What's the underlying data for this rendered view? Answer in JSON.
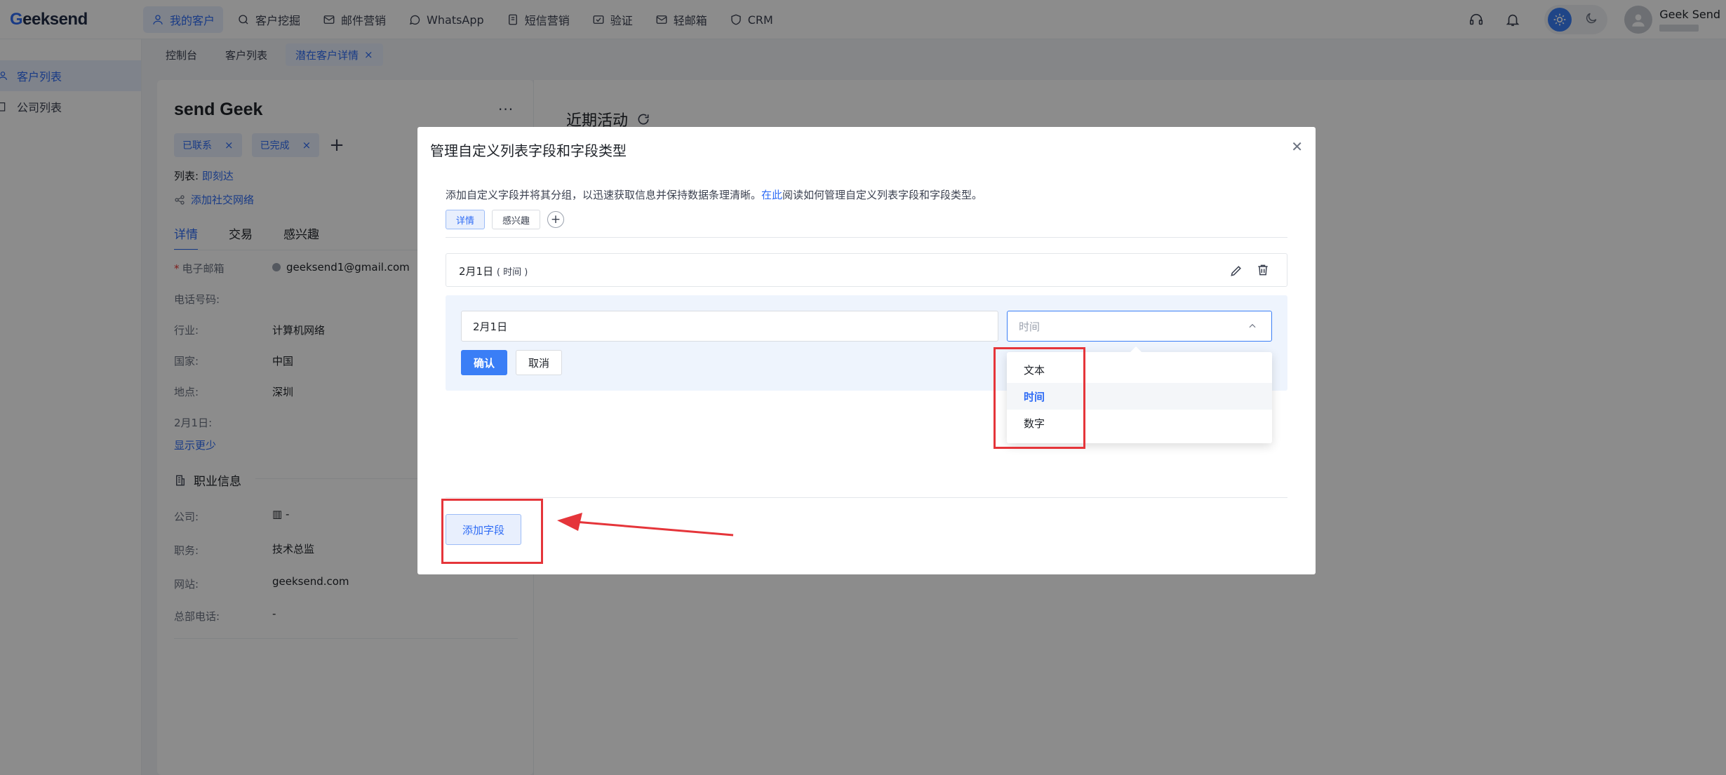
{
  "app": {
    "logo_g": "G",
    "logo_rest": "eeksend"
  },
  "nav": [
    {
      "label": "我的客户",
      "icon": "user-icon"
    },
    {
      "label": "客户挖掘",
      "icon": "search-icon"
    },
    {
      "label": "邮件营销",
      "icon": "mail-icon"
    },
    {
      "label": "WhatsApp",
      "icon": "whatsapp-icon"
    },
    {
      "label": "短信营销",
      "icon": "sms-icon"
    },
    {
      "label": "验证",
      "icon": "verify-icon"
    },
    {
      "label": "轻邮箱",
      "icon": "light-mail-icon"
    },
    {
      "label": "CRM",
      "icon": "shield-icon"
    }
  ],
  "user": {
    "name": "Geek Send"
  },
  "sidebar": {
    "items": [
      {
        "label": "客户列表"
      },
      {
        "label": "公司列表"
      }
    ]
  },
  "page_tabs": [
    {
      "label": "控制台"
    },
    {
      "label": "客户列表"
    },
    {
      "label": "潜在客户详情"
    }
  ],
  "detail": {
    "name": "send Geek",
    "more": "···",
    "tags": [
      "已联系",
      "已完成"
    ],
    "list_label": "列表:",
    "list_value": "即刻达",
    "add_social": "添加社交网络",
    "tabs": [
      "详情",
      "交易",
      "感兴趣"
    ],
    "fields": [
      {
        "label": "电子邮箱",
        "value": "geeksend1@gmail.com"
      },
      {
        "label": "电话号码:",
        "value": ""
      },
      {
        "label": "行业:",
        "value": "计算机网络"
      },
      {
        "label": "国家:",
        "value": "中国"
      },
      {
        "label": "地点:",
        "value": "深圳"
      },
      {
        "label": "2月1日:",
        "value": ""
      }
    ],
    "show_less": "显示更少",
    "job_title": "职业信息",
    "job_fields": [
      {
        "label": "公司:",
        "value": "-"
      },
      {
        "label": "职务:",
        "value": "技术总监"
      },
      {
        "label": "网站:",
        "value": "geeksend.com"
      },
      {
        "label": "总部电话:",
        "value": "-"
      }
    ]
  },
  "activity": {
    "title": "近期活动"
  },
  "modal": {
    "title": "管理自定义列表字段和字段类型",
    "desc_before": "添加自定义字段并将其分组，以迅速获取信息并保持数据条理清晰。",
    "desc_link": "在此",
    "desc_after": "阅读如何管理自定义列表字段和字段类型。",
    "tabs": [
      "详情",
      "感兴趣"
    ],
    "field_row": {
      "name": "2月1日",
      "type": "( 时间 )"
    },
    "input_value": "2月1日",
    "select_placeholder": "时间",
    "confirm": "确认",
    "cancel": "取消",
    "options": [
      "文本",
      "时间",
      "数字"
    ],
    "selected_option": "时间",
    "add_field": "添加字段"
  },
  "colors": {
    "accent": "#2f6cf5",
    "annotation": "#e5353a"
  }
}
